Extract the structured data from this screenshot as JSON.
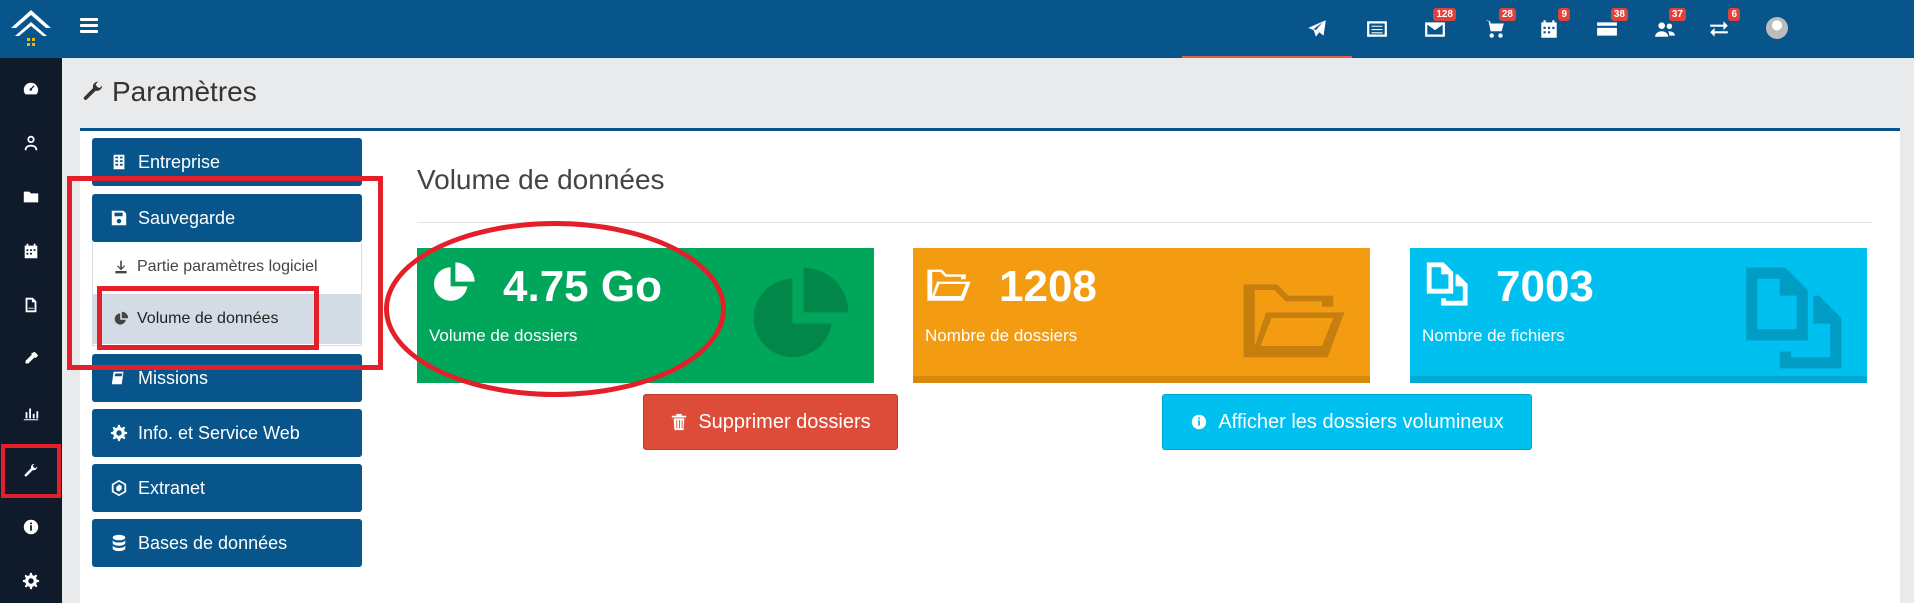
{
  "page": {
    "title": "Paramètres"
  },
  "topbar": {
    "badges": {
      "messages": "128",
      "cart": "28",
      "calendar": "9",
      "cards": "38",
      "users": "37",
      "transfers": "6"
    }
  },
  "menu": {
    "items": [
      {
        "label": "Entreprise"
      },
      {
        "label": "Sauvegarde"
      },
      {
        "label": "Missions"
      },
      {
        "label": "Info. et Service Web"
      },
      {
        "label": "Extranet"
      },
      {
        "label": "Bases de données"
      }
    ],
    "submenu": [
      {
        "label": "Partie paramètres logiciel"
      },
      {
        "label": "Volume de données"
      }
    ]
  },
  "main": {
    "title": "Volume de données",
    "stats": [
      {
        "value": "4.75 Go",
        "label": "Volume de dossiers",
        "color": "#00a65a"
      },
      {
        "value": "1208",
        "label": "Nombre de dossiers",
        "color": "#f39c12"
      },
      {
        "value": "7003",
        "label": "Nombre de fichiers",
        "color": "#00c0ef"
      }
    ],
    "buttons": {
      "delete": "Supprimer dossiers",
      "show_large": "Afficher les dossiers volumineux"
    }
  },
  "colors": {
    "brand": "#07558a",
    "highlight": "#e3202a",
    "danger": "#dd4b39",
    "info": "#00c0ef"
  }
}
